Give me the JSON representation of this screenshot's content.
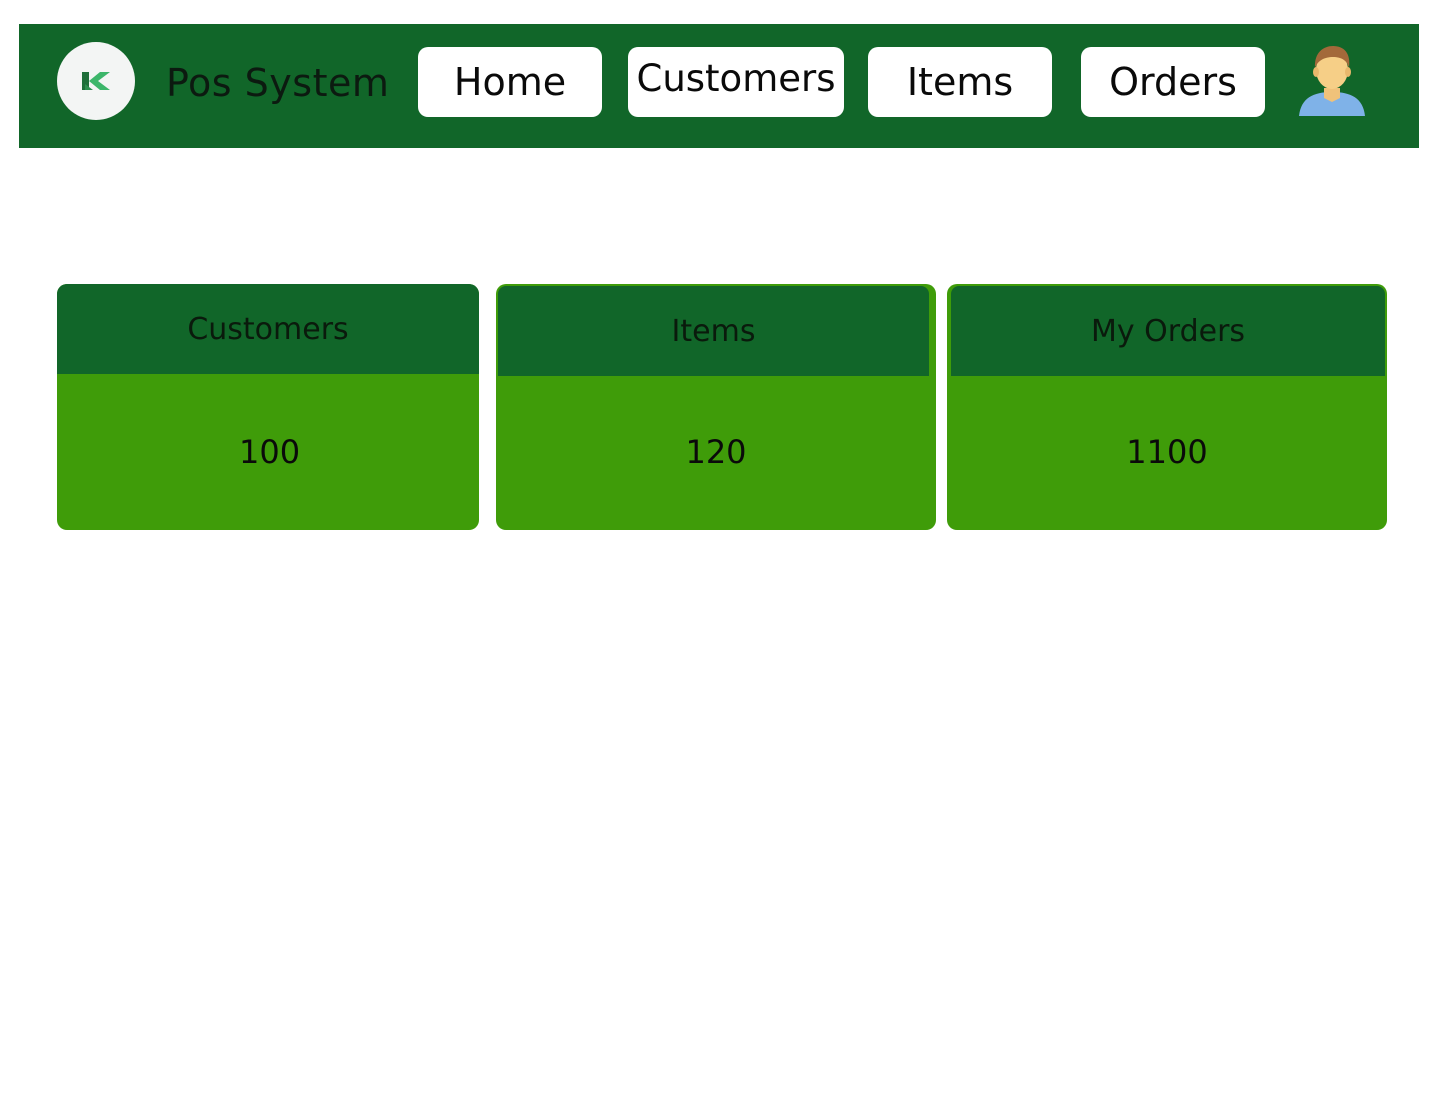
{
  "header": {
    "brand": "Pos System",
    "logo_icon": "k-logo-icon",
    "avatar_icon": "user-avatar-icon",
    "nav": {
      "home": "Home",
      "customers": "Customers",
      "items": "Items",
      "orders": "Orders"
    }
  },
  "cards": [
    {
      "title": "Customers",
      "value": "100"
    },
    {
      "title": "Items",
      "value": "120"
    },
    {
      "title": "My Orders",
      "value": "1100"
    }
  ],
  "colors": {
    "nav_bg": "#116629",
    "card_header": "#116629",
    "card_body": "#3f9c09"
  }
}
